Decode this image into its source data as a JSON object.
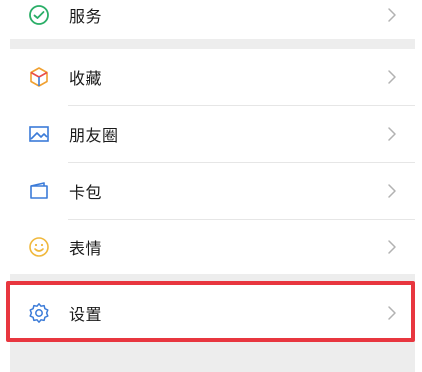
{
  "menu": {
    "services": {
      "label": "服务",
      "icon": "wechat-pay-icon",
      "color": "#2aae67"
    },
    "favorites": {
      "label": "收藏",
      "icon": "cube-icon"
    },
    "moments": {
      "label": "朋友圈",
      "icon": "image-icon",
      "color": "#3b7bd8"
    },
    "cards": {
      "label": "卡包",
      "icon": "card-wallet-icon",
      "color": "#3b7bd8"
    },
    "stickers": {
      "label": "表情",
      "icon": "smiley-icon",
      "color": "#f0b83c"
    },
    "settings": {
      "label": "设置",
      "icon": "gear-icon",
      "color": "#3b7bd8"
    }
  },
  "highlight_color": "#e8363f"
}
